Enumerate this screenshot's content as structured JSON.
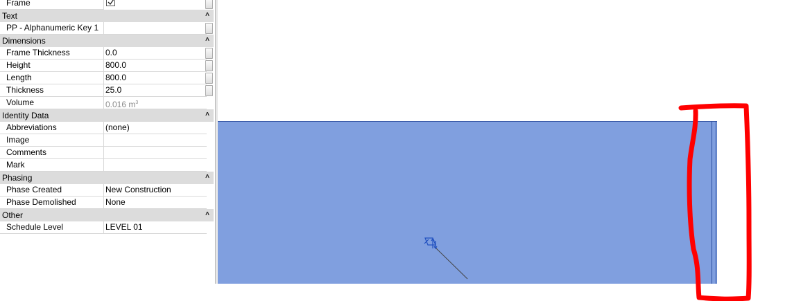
{
  "properties": {
    "rows": [
      {
        "kind": "param",
        "label": "Frame",
        "type": "checkbox",
        "checked": true
      },
      {
        "kind": "group",
        "label": "Text"
      },
      {
        "kind": "param",
        "label": "PP - Alphanumeric Key 1",
        "value": ""
      },
      {
        "kind": "group",
        "label": "Dimensions"
      },
      {
        "kind": "param",
        "label": "Frame Thickness",
        "value": "0.0"
      },
      {
        "kind": "param",
        "label": "Height",
        "value": "800.0"
      },
      {
        "kind": "param",
        "label": "Length",
        "value": "800.0"
      },
      {
        "kind": "param",
        "label": "Thickness",
        "value": "25.0"
      },
      {
        "kind": "param",
        "label": "Volume",
        "value": "0.016 m",
        "superscript": "3",
        "disabled": true
      },
      {
        "kind": "group",
        "label": "Identity Data"
      },
      {
        "kind": "param",
        "label": "Abbreviations",
        "value": "(none)"
      },
      {
        "kind": "param",
        "label": "Image",
        "value": ""
      },
      {
        "kind": "param",
        "label": "Comments",
        "value": ""
      },
      {
        "kind": "param",
        "label": "Mark",
        "value": ""
      },
      {
        "kind": "group",
        "label": "Phasing"
      },
      {
        "kind": "param",
        "label": "Phase Created",
        "value": "New Construction"
      },
      {
        "kind": "param",
        "label": "Phase Demolished",
        "value": "None"
      },
      {
        "kind": "group",
        "label": "Other"
      },
      {
        "kind": "param",
        "label": "Schedule Level",
        "value": "LEVEL 01"
      }
    ],
    "collapse_glyph": "˄"
  },
  "canvas": {
    "panel_color": "#809fdf",
    "edge_color": "#2b4e9e",
    "annotation_color": "#ff0000",
    "icons": [
      "panel-tag-icon"
    ]
  }
}
